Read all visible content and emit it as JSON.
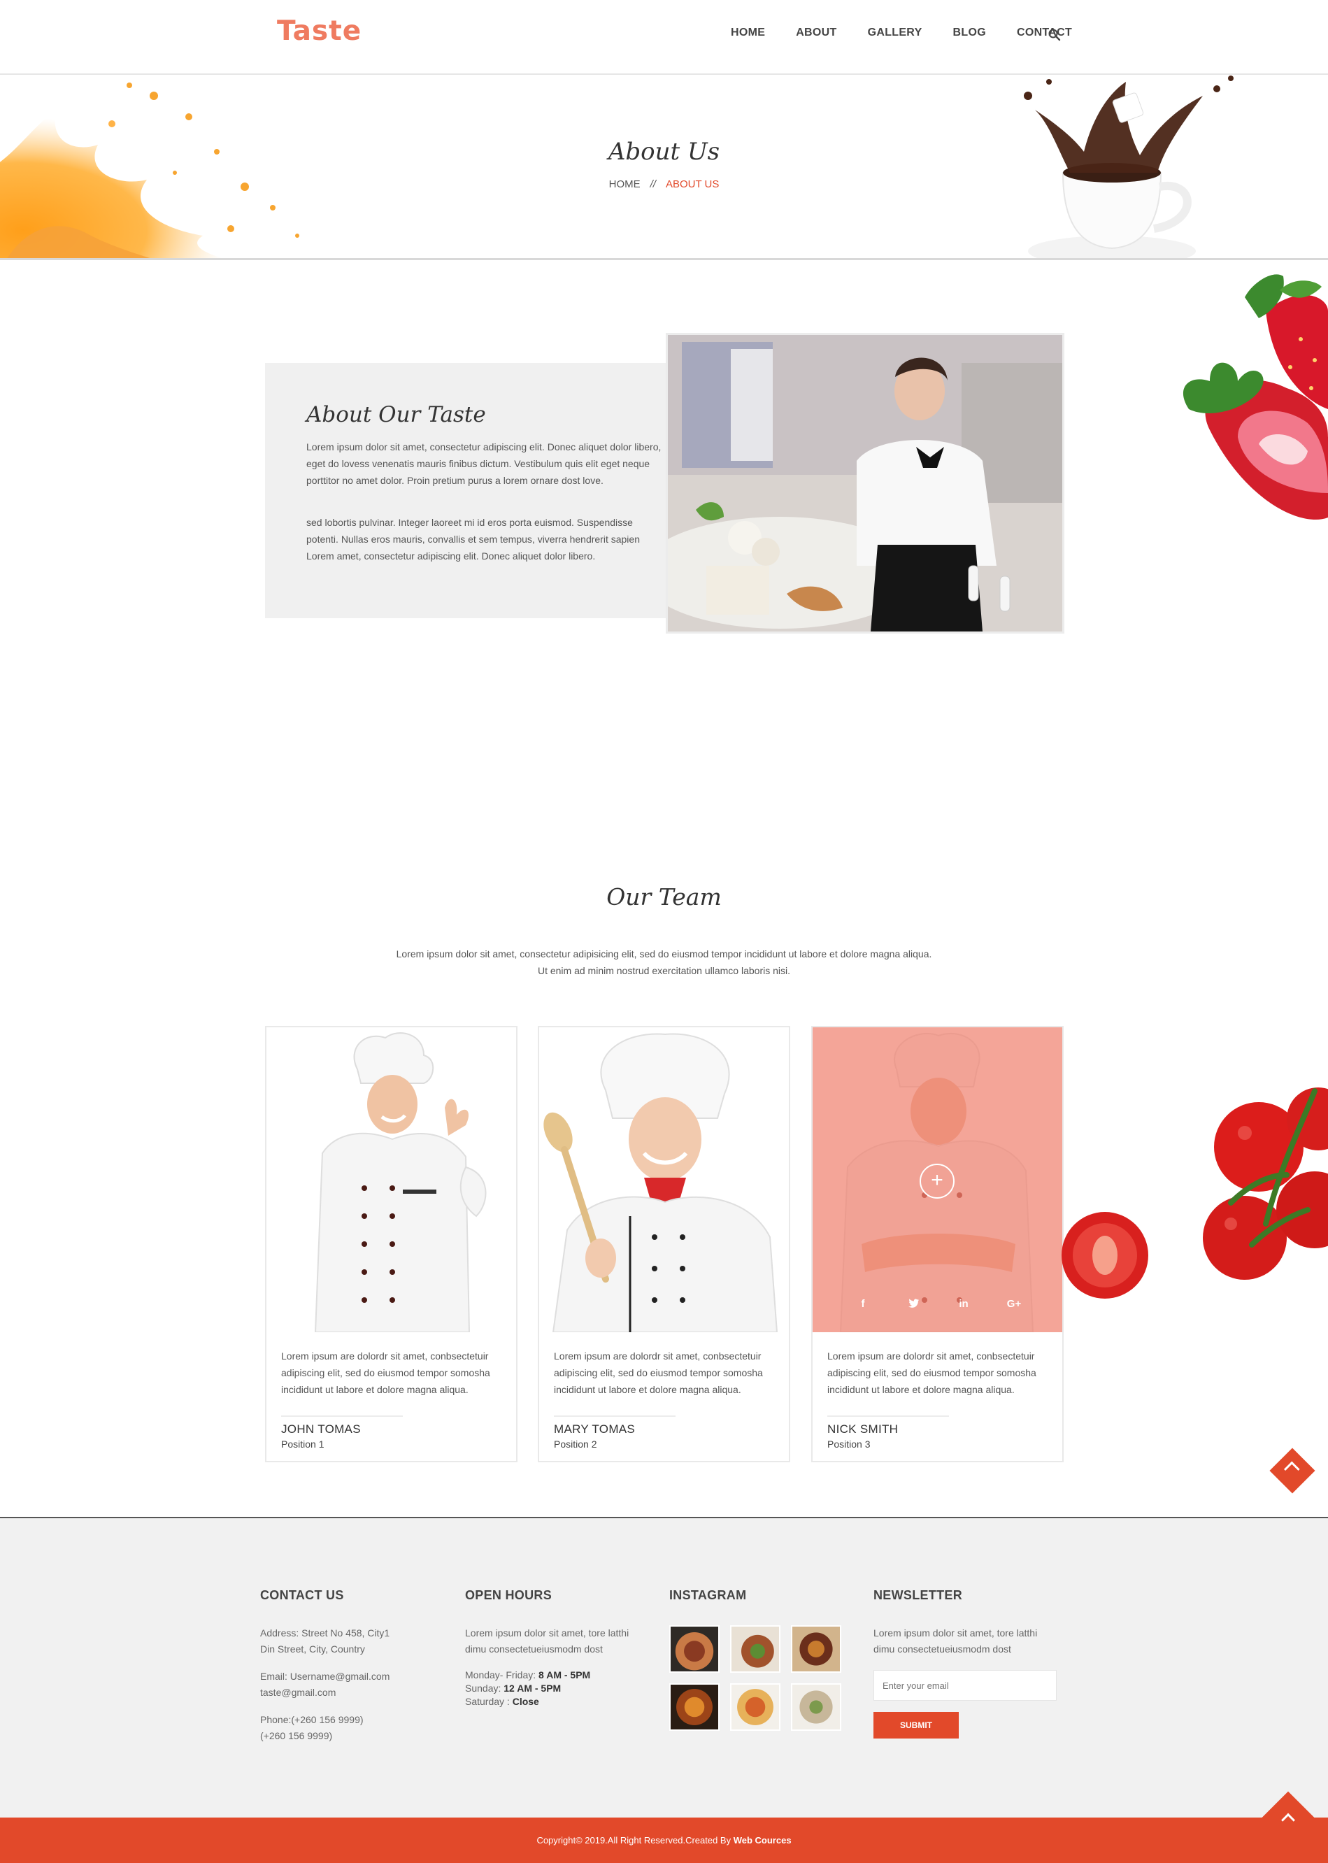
{
  "header": {
    "logo": "Taste",
    "nav": [
      "HOME",
      "ABOUT",
      "GALLERY",
      "BLOG",
      "CONTACT"
    ]
  },
  "banner": {
    "title": "About Us",
    "crumb_home": "HOME",
    "crumb_sep": "//",
    "crumb_active": "ABOUT US"
  },
  "about": {
    "title": "About Our Taste",
    "p1": "Lorem ipsum dolor sit amet, consectetur adipiscing elit. Donec aliquet dolor libero, eget do lovess venenatis mauris finibus dictum. Vestibulum quis elit eget neque porttitor no amet dolor. Proin pretium purus a lorem ornare dost love.",
    "p2": "sed lobortis pulvinar. Integer laoreet mi id eros porta euismod. Suspendisse potenti. Nullas eros mauris, convallis et sem tempus, viverra hendrerit sapien Lorem amet, consectetur adipiscing elit. Donec aliquet dolor libero."
  },
  "team": {
    "title": "Our Team",
    "intro1": "Lorem ipsum dolor sit amet, consectetur adipisicing elit, sed do eiusmod tempor incididunt ut labore et dolore magna aliqua.",
    "intro2": "Ut enim ad minim nostrud exercitation ullamco laboris nisi.",
    "members": [
      {
        "text": "Lorem ipsum are dolordr sit amet, conbsectetuir adipiscing elit, sed do eiusmod tempor somosha incididunt ut labore et dolore magna aliqua.",
        "name": "JOHN TOMAS",
        "position": "Position 1"
      },
      {
        "text": "Lorem ipsum are dolordr sit amet, conbsectetuir adipiscing elit, sed do eiusmod tempor somosha incididunt ut labore et dolore magna aliqua.",
        "name": "MARY TOMAS",
        "position": "Position 2"
      },
      {
        "text": "Lorem ipsum are dolordr sit amet, conbsectetuir adipiscing elit, sed do eiusmod tempor somosha incididunt ut labore et dolore magna aliqua.",
        "name": "NICK SMITH",
        "position": "Position 3"
      }
    ],
    "socials": [
      "f",
      "t",
      "in",
      "G+"
    ]
  },
  "footer": {
    "contact": {
      "title": "CONTACT US",
      "address1": "Address: Street No 458, City1",
      "address2": "Din Street, City, Country",
      "email1": "Email: Username@gmail.com",
      "email2": "taste@gmail.com",
      "phone1": "Phone:(+260 156 9999)",
      "phone2": "(+260 156 9999)"
    },
    "hours": {
      "title": "OPEN HOURS",
      "desc1": "Lorem ipsum dolor sit amet, tore latthi",
      "desc2": "dimu consectetueiusmodm dost",
      "l1_label": "Monday- Friday: ",
      "l1_value": "8 AM - 5PM",
      "l2_label": "Sunday: ",
      "l2_value": "12 AM - 5PM",
      "l3_label": "Saturday : ",
      "l3_value": "Close"
    },
    "instagram": {
      "title": "INSTAGRAM"
    },
    "newsletter": {
      "title": "NEWSLETTER",
      "desc1": "Lorem ipsum dolor sit amet, tore latthi",
      "desc2": "dimu consectetueiusmodm dost",
      "placeholder": "Enter your email",
      "submit": "SUBMIT"
    },
    "copyright": "Copyright© 2019.All Right Reserved.Created By ",
    "copyright_brand": "Web Cources"
  },
  "colors": {
    "accent": "#e2492a",
    "logo": "#ef7b60",
    "overlay": "#f08270"
  }
}
